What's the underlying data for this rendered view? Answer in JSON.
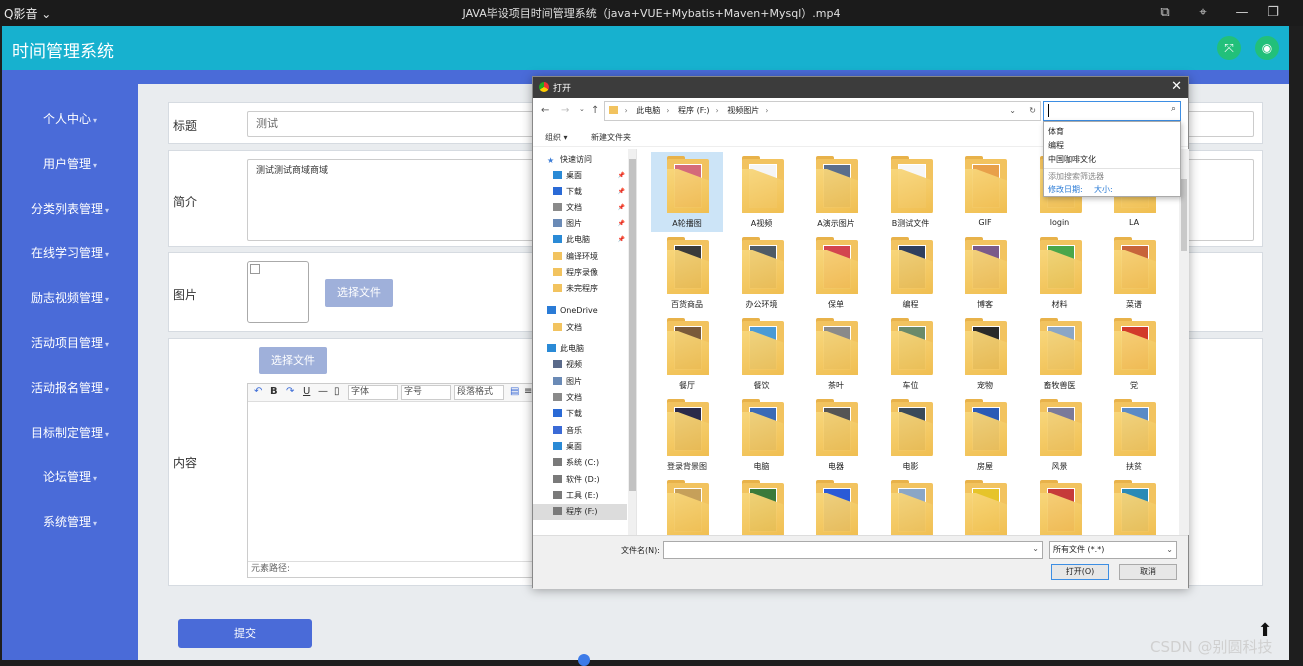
{
  "player": {
    "brand": "Q影音",
    "title": "JAVA毕设项目时间管理系统（java+VUE+Mybatis+Maven+Mysql）.mp4"
  },
  "app": {
    "title": "时间管理系统",
    "sidebar": [
      {
        "label": "个人中心"
      },
      {
        "label": "用户管理"
      },
      {
        "label": "分类列表管理"
      },
      {
        "label": "在线学习管理"
      },
      {
        "label": "励志视频管理"
      },
      {
        "label": "活动项目管理"
      },
      {
        "label": "活动报名管理"
      },
      {
        "label": "目标制定管理"
      },
      {
        "label": "论坛管理"
      },
      {
        "label": "系统管理"
      }
    ],
    "form": {
      "title_label": "标题",
      "title_value": "测试",
      "intro_label": "简介",
      "intro_value": "测试测试商域商域",
      "image_label": "图片",
      "choose_file": "选择文件",
      "content_label": "内容",
      "content_choose_file": "选择文件",
      "editor_font": "字体",
      "editor_size": "字号",
      "editor_para": "段落格式",
      "editor_path": "元素路径:",
      "submit": "提交"
    }
  },
  "dialog": {
    "title": "打开",
    "breadcrumb": [
      "此电脑",
      "程序 (F:)",
      "视频图片"
    ],
    "organize": "组织 ▾",
    "new_folder": "新建文件夹",
    "nav": [
      {
        "label": "快速访问",
        "icon": "star-icon",
        "pinned": false
      },
      {
        "label": "桌面",
        "icon": "desktop-icon",
        "pinned": true
      },
      {
        "label": "下载",
        "icon": "download-icon",
        "pinned": true
      },
      {
        "label": "文档",
        "icon": "document-icon",
        "pinned": true
      },
      {
        "label": "图片",
        "icon": "picture-icon",
        "pinned": true
      },
      {
        "label": "此电脑",
        "icon": "computer-icon",
        "pinned": true
      },
      {
        "label": "编译环境",
        "icon": "folder-icon",
        "pinned": false
      },
      {
        "label": "程序录像",
        "icon": "folder-icon",
        "pinned": false
      },
      {
        "label": "未完程序",
        "icon": "folder-icon",
        "pinned": false
      },
      {
        "label": "OneDrive",
        "icon": "cloud-icon",
        "pinned": false
      },
      {
        "label": "文档",
        "icon": "folder-icon",
        "pinned": false
      },
      {
        "label": "此电脑",
        "icon": "computer-icon",
        "pinned": false
      },
      {
        "label": "视频",
        "icon": "video-icon",
        "pinned": false
      },
      {
        "label": "图片",
        "icon": "picture-icon",
        "pinned": false
      },
      {
        "label": "文档",
        "icon": "document-icon",
        "pinned": false
      },
      {
        "label": "下载",
        "icon": "download-icon",
        "pinned": false
      },
      {
        "label": "音乐",
        "icon": "music-icon",
        "pinned": false
      },
      {
        "label": "桌面",
        "icon": "desktop-icon",
        "pinned": false
      },
      {
        "label": "系统 (C:)",
        "icon": "drive-icon",
        "pinned": false
      },
      {
        "label": "软件 (D:)",
        "icon": "drive-icon",
        "pinned": false
      },
      {
        "label": "工具 (E:)",
        "icon": "drive-icon",
        "pinned": false
      },
      {
        "label": "程序 (F:)",
        "icon": "drive-icon",
        "pinned": false
      }
    ],
    "files": [
      {
        "name": "A轮播图",
        "color": "#d46a7a"
      },
      {
        "name": "A视频",
        "color": "#f5f5f5"
      },
      {
        "name": "A演示图片",
        "color": "#5a6e8c"
      },
      {
        "name": "B测试文件",
        "color": "#f7f7f7"
      },
      {
        "name": "GIF",
        "color": "#e8a04a"
      },
      {
        "name": "login",
        "color": "#c08a5a"
      },
      {
        "name": "LA",
        "color": "#e9c98d"
      },
      {
        "name": "百货商品",
        "color": "#3a3a3a"
      },
      {
        "name": "办公环境",
        "color": "#4f5b66"
      },
      {
        "name": "保单",
        "color": "#d3454f"
      },
      {
        "name": "编程",
        "color": "#2f3f5e"
      },
      {
        "name": "博客",
        "color": "#7a5a8a"
      },
      {
        "name": "材料",
        "color": "#4aa64a"
      },
      {
        "name": "菜谱",
        "color": "#c7643a"
      },
      {
        "name": "餐厅",
        "color": "#7a5a3a"
      },
      {
        "name": "餐饮",
        "color": "#4a9ad6"
      },
      {
        "name": "茶叶",
        "color": "#8a8a8a"
      },
      {
        "name": "车位",
        "color": "#6a8a6a"
      },
      {
        "name": "宠物",
        "color": "#2a2a2a"
      },
      {
        "name": "畜牧兽医",
        "color": "#8aa6c6"
      },
      {
        "name": "党",
        "color": "#d23a2a"
      },
      {
        "name": "登录背景图",
        "color": "#2a2a4a"
      },
      {
        "name": "电脑",
        "color": "#3a6ab6"
      },
      {
        "name": "电器",
        "color": "#555555"
      },
      {
        "name": "电影",
        "color": "#3a4a5a"
      },
      {
        "name": "房屋",
        "color": "#2a5ab6"
      },
      {
        "name": "风景",
        "color": "#7a7a9a"
      },
      {
        "name": "扶贫",
        "color": "#5a8ac6"
      },
      {
        "name": "",
        "color": "#c6a05a"
      },
      {
        "name": "",
        "color": "#3a7a3a"
      },
      {
        "name": "",
        "color": "#2a5ad6"
      },
      {
        "name": "",
        "color": "#8aa6c6"
      },
      {
        "name": "",
        "color": "#e6c42a"
      },
      {
        "name": "",
        "color": "#c63a3a"
      },
      {
        "name": "",
        "color": "#2a8ab6"
      }
    ],
    "search_suggestions": [
      "体育",
      "编程",
      "中国咖啡文化"
    ],
    "add_filter": "添加搜索筛选器",
    "filter_date": "修改日期:",
    "filter_size": "大小:",
    "filename_label": "文件名(N):",
    "filetype": "所有文件 (*.*)",
    "open_button": "打开(O)",
    "cancel_button": "取消"
  },
  "watermark": "CSDN @别圆科技"
}
